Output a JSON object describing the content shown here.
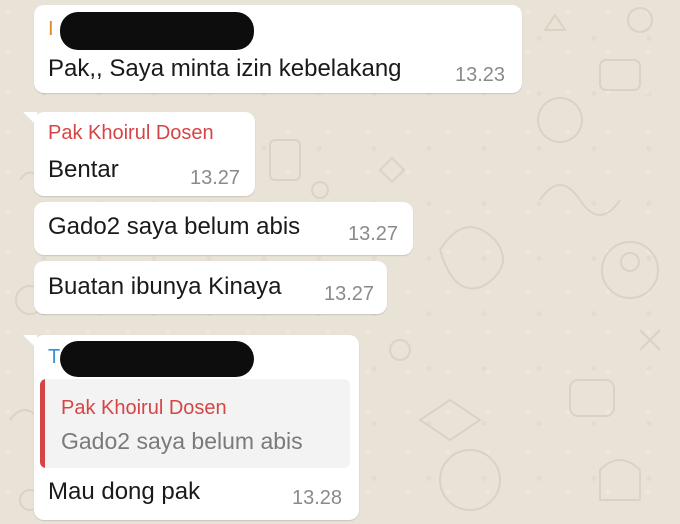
{
  "colors": {
    "chat_background": "#e9e2d6",
    "bubble_background": "#ffffff",
    "sender_orange": "#e08a2e",
    "sender_red": "#d64545",
    "sender_blue": "#3a8fd9",
    "time_gray": "#8a8a8a",
    "quote_bar": "#d64545"
  },
  "messages": [
    {
      "sender_initial": "I",
      "sender_redacted": true,
      "text": "Pak,, Saya minta izin kebelakang",
      "time": "13.23"
    },
    {
      "sender": "Pak Khoirul Dosen",
      "text": "Bentar",
      "time": "13.27"
    },
    {
      "text": "Gado2 saya belum abis",
      "time": "13.27"
    },
    {
      "text": "Buatan ibunya Kinaya",
      "time": "13.27"
    },
    {
      "sender_initial": "T",
      "sender_redacted": true,
      "quote": {
        "sender": "Pak Khoirul Dosen",
        "text": "Gado2 saya belum abis"
      },
      "text": "Mau dong pak",
      "time": "13.28"
    }
  ]
}
